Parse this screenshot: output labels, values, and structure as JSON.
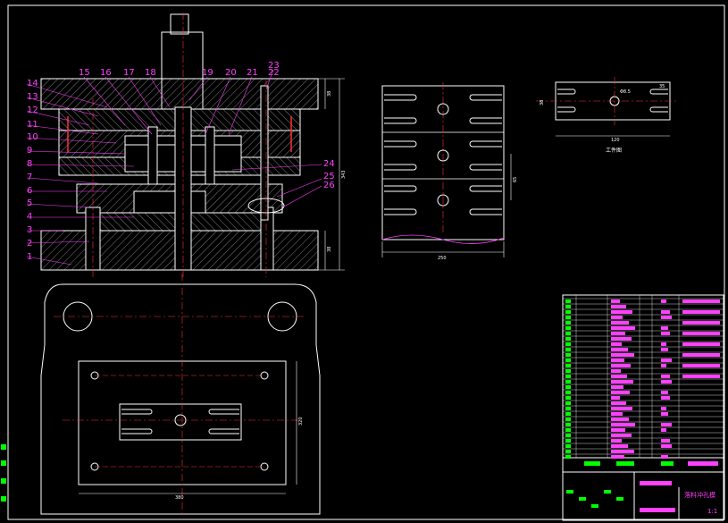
{
  "drawing": {
    "part_numbers": [
      "1",
      "2",
      "3",
      "4",
      "5",
      "6",
      "7",
      "8",
      "9",
      "10",
      "11",
      "12",
      "13",
      "14",
      "15",
      "16",
      "17",
      "18",
      "19",
      "20",
      "21",
      "22",
      "23",
      "24",
      "25",
      "26"
    ],
    "dimensions": {
      "front_height": "343",
      "top_plate_thickness": "38",
      "base_plate_thickness": "38",
      "strip_width": "250",
      "strip_pitch": "65",
      "part_length": "120",
      "part_height": "38",
      "part_small": "35",
      "hole_dia": "Φ8.5",
      "base_length": "380",
      "base_width": "320"
    },
    "workpiece_caption": "工件图",
    "title_block": {
      "drawing_title": "落料冲孔模",
      "scale": "1:1"
    }
  }
}
